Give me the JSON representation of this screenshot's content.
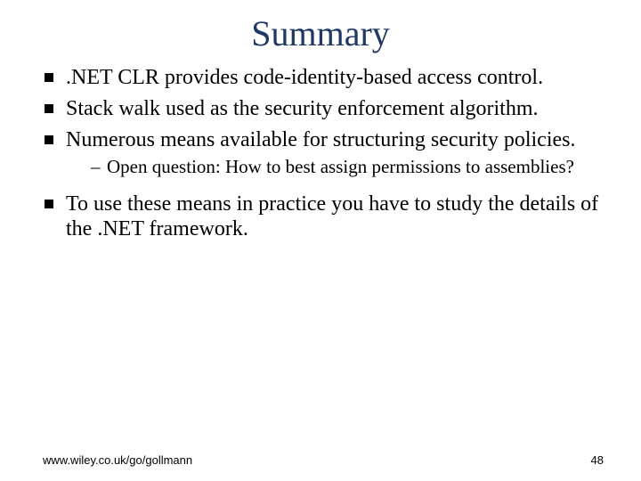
{
  "title": "Summary",
  "bullets": {
    "b1": ".NET CLR provides code-identity-based access control.",
    "b2": "Stack walk used as the security enforcement algorithm.",
    "b3": "Numerous means available for structuring security policies.",
    "b3_sub1": "Open question: How to best assign permissions to assemblies?",
    "b4": "To use these means in practice you have to study the details of the .NET framework."
  },
  "footer": {
    "left": "www.wiley.co.uk/go/gollmann",
    "page": "48"
  }
}
